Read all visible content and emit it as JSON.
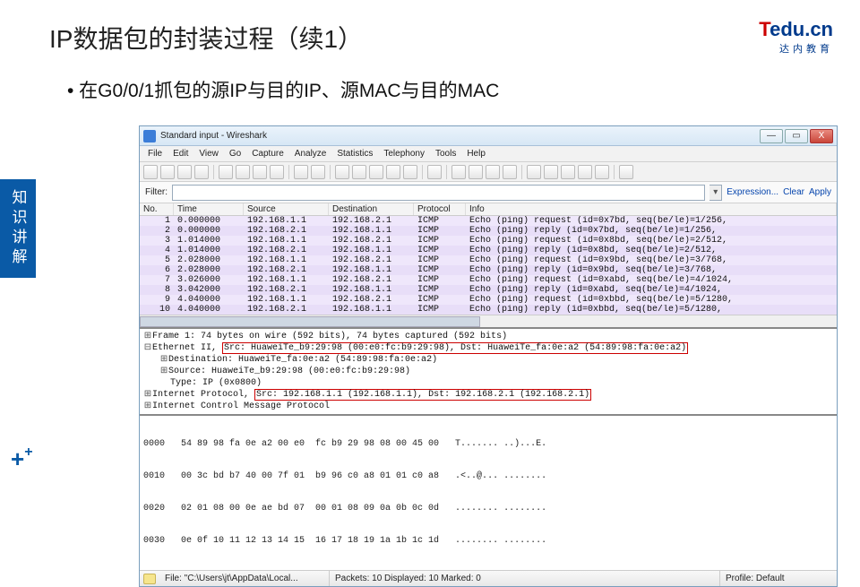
{
  "slide": {
    "title": "IP数据包的封装过程（续1）",
    "bullet": "•  在G0/0/1抓包的源IP与目的IP、源MAC与目的MAC",
    "sidebar": "知识讲解",
    "logo_t": "T",
    "logo_rest": "edu.cn",
    "logo_sub": "达内教育"
  },
  "win": {
    "title": "Standard input  -  Wireshark",
    "min": "—",
    "max": "▭",
    "close": "X"
  },
  "menu": [
    "File",
    "Edit",
    "View",
    "Go",
    "Capture",
    "Analyze",
    "Statistics",
    "Telephony",
    "Tools",
    "Help"
  ],
  "filter": {
    "label": "Filter:",
    "drop": "▾",
    "expr": "Expression...",
    "clear": "Clear",
    "apply": "Apply"
  },
  "cols": [
    "No.",
    "Time",
    "Source",
    "Destination",
    "Protocol",
    "Info"
  ],
  "rows": [
    {
      "n": "1",
      "t": "0.000000",
      "s": "192.168.1.1",
      "d": "192.168.2.1",
      "p": "ICMP",
      "i": "Echo (ping) request  (id=0x7bd, seq(be/le)=1/256,"
    },
    {
      "n": "2",
      "t": "0.000000",
      "s": "192.168.2.1",
      "d": "192.168.1.1",
      "p": "ICMP",
      "i": "Echo (ping) reply    (id=0x7bd, seq(be/le)=1/256,"
    },
    {
      "n": "3",
      "t": "1.014000",
      "s": "192.168.1.1",
      "d": "192.168.2.1",
      "p": "ICMP",
      "i": "Echo (ping) request  (id=0x8bd, seq(be/le)=2/512,"
    },
    {
      "n": "4",
      "t": "1.014000",
      "s": "192.168.2.1",
      "d": "192.168.1.1",
      "p": "ICMP",
      "i": "Echo (ping) reply    (id=0x8bd, seq(be/le)=2/512,"
    },
    {
      "n": "5",
      "t": "2.028000",
      "s": "192.168.1.1",
      "d": "192.168.2.1",
      "p": "ICMP",
      "i": "Echo (ping) request  (id=0x9bd, seq(be/le)=3/768,"
    },
    {
      "n": "6",
      "t": "2.028000",
      "s": "192.168.2.1",
      "d": "192.168.1.1",
      "p": "ICMP",
      "i": "Echo (ping) reply    (id=0x9bd, seq(be/le)=3/768,"
    },
    {
      "n": "7",
      "t": "3.026000",
      "s": "192.168.1.1",
      "d": "192.168.2.1",
      "p": "ICMP",
      "i": "Echo (ping) request  (id=0xabd, seq(be/le)=4/1024,"
    },
    {
      "n": "8",
      "t": "3.042000",
      "s": "192.168.2.1",
      "d": "192.168.1.1",
      "p": "ICMP",
      "i": "Echo (ping) reply    (id=0xabd, seq(be/le)=4/1024,"
    },
    {
      "n": "9",
      "t": "4.040000",
      "s": "192.168.1.1",
      "d": "192.168.2.1",
      "p": "ICMP",
      "i": "Echo (ping) request  (id=0xbbd, seq(be/le)=5/1280,"
    },
    {
      "n": "10",
      "t": "4.040000",
      "s": "192.168.2.1",
      "d": "192.168.1.1",
      "p": "ICMP",
      "i": "Echo (ping) reply    (id=0xbbd, seq(be/le)=5/1280,"
    }
  ],
  "details": {
    "l1": "Frame 1: 74 bytes on wire (592 bits), 74 bytes captured (592 bits)",
    "l2a": "Ethernet II, ",
    "l2b": "Src: HuaweiTe_b9:29:98 (00:e0:fc:b9:29:98), Dst: HuaweiTe_fa:0e:a2 (54:89:98:fa:0e:a2)",
    "l3": "Destination: HuaweiTe_fa:0e:a2 (54:89:98:fa:0e:a2)",
    "l4": "Source: HuaweiTe_b9:29:98 (00:e0:fc:b9:29:98)",
    "l5": "Type: IP (0x0800)",
    "l6a": "Internet Protocol, ",
    "l6b": "Src: 192.168.1.1 (192.168.1.1), Dst: 192.168.2.1 (192.168.2.1)",
    "l7": "Internet Control Message Protocol"
  },
  "hex": {
    "r0": "0000   54 89 98 fa 0e a2 00 e0  fc b9 29 98 08 00 45 00   T....... ..)...E.",
    "r1": "0010   00 3c bd b7 40 00 7f 01  b9 96 c0 a8 01 01 c0 a8   .<..@... ........",
    "r2": "0020   02 01 08 00 0e ae bd 07  00 01 08 09 0a 0b 0c 0d   ........ ........",
    "r3": "0030   0e 0f 10 11 12 13 14 15  16 17 18 19 1a 1b 1c 1d   ........ ........"
  },
  "status": {
    "path": "File: \"C:\\Users\\jt\\AppData\\Local...",
    "mid": "Packets: 10 Displayed: 10 Marked: 0",
    "right": "Profile: Default"
  }
}
